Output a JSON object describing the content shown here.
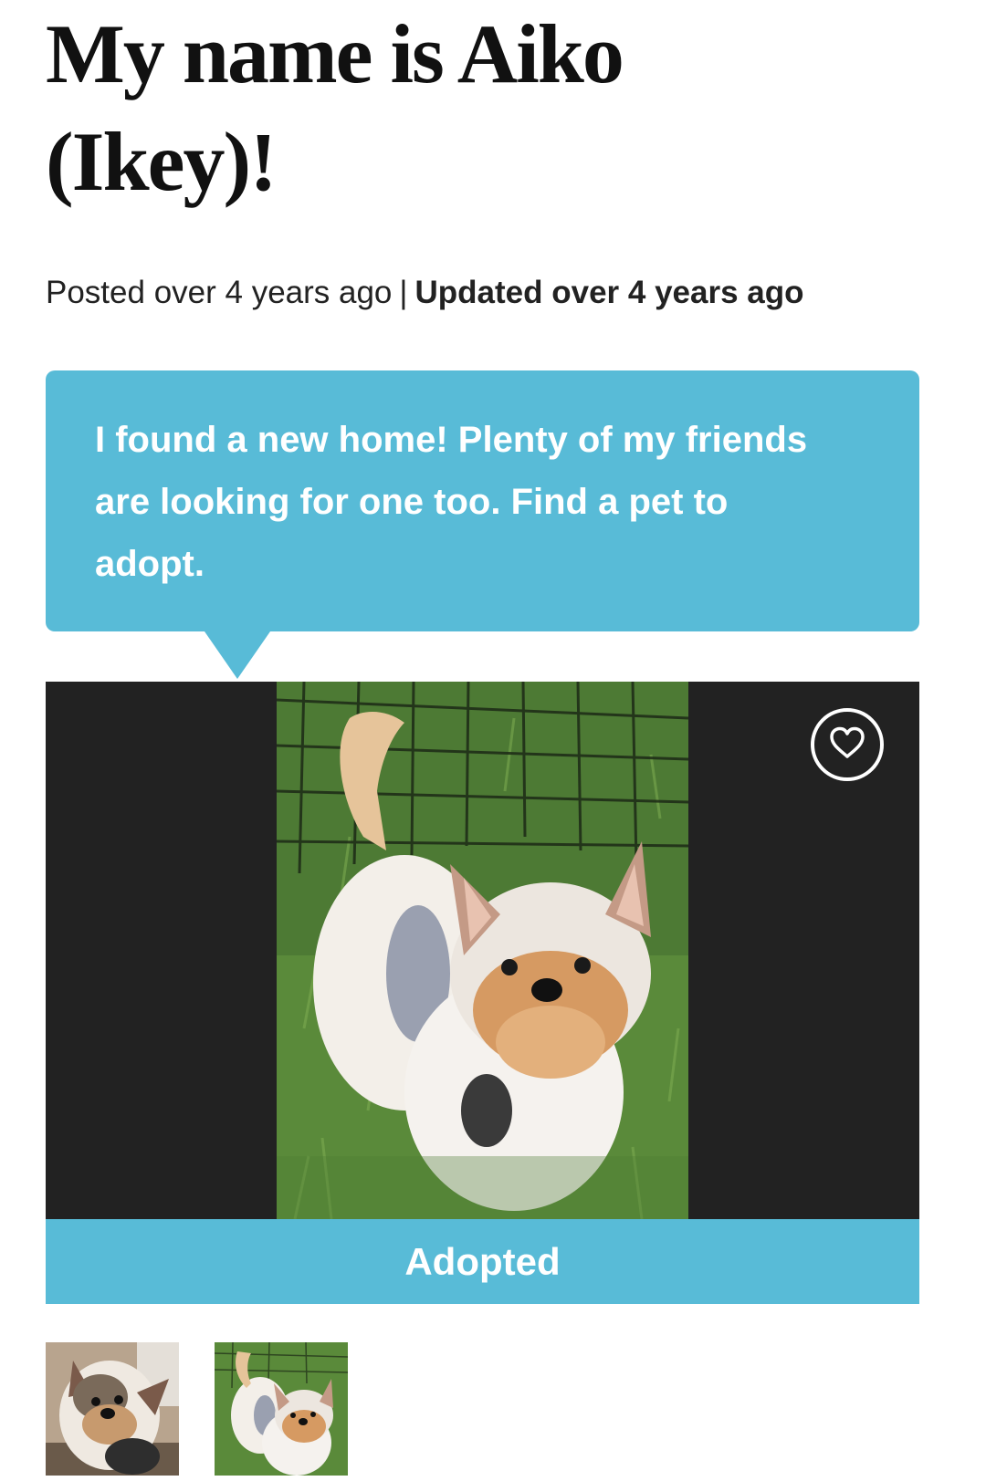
{
  "pet": {
    "title_line1": "My name is Aiko",
    "title_line2": "(Ikey)!",
    "posted": "Posted over 4 years ago",
    "separator": "|",
    "updated": "Updated over 4 years ago"
  },
  "banner": {
    "text": "I found a new home! Plenty of my friends are looking for one too.",
    "link_text": "Find a pet to adopt."
  },
  "photo": {
    "favorite_icon": "heart-icon",
    "status_label": "Adopted"
  },
  "thumbnails": {
    "count": 2
  },
  "colors": {
    "accent": "#58bbd7",
    "photo_background": "#222222",
    "title": "#111111"
  }
}
